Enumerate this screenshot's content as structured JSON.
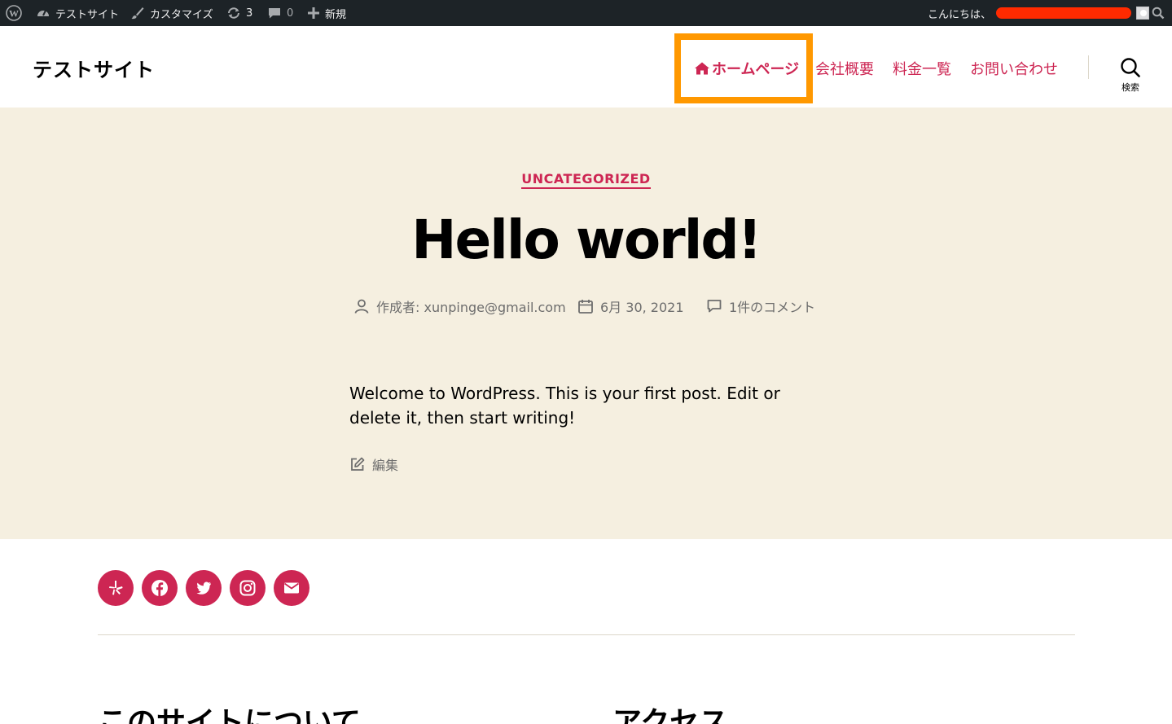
{
  "admin_bar": {
    "site_name": "テストサイト",
    "customize": "カスタマイズ",
    "updates_count": "3",
    "comments_count": "0",
    "new_label": "新規",
    "greeting": "こんにちは、"
  },
  "header": {
    "site_title": "テストサイト",
    "nav": [
      {
        "label": "ホームページ"
      },
      {
        "label": "会社概要"
      },
      {
        "label": "料金一覧"
      },
      {
        "label": "お問い合わせ"
      }
    ],
    "search_label": "検索"
  },
  "post": {
    "category": "UNCATEGORIZED",
    "title": "Hello world!",
    "author": "作成者: xunpinge@gmail.com",
    "date": "6月 30, 2021",
    "comments": "1件のコメント",
    "body": "Welcome to WordPress. This is your first post. Edit or delete it, then start writing!",
    "edit_label": "編集"
  },
  "footer": {
    "widget_titles": [
      "このサイトについて",
      "アクセス"
    ]
  },
  "colors": {
    "accent": "#cd2653",
    "highlight": "#ff9800",
    "admin_bar_bg": "#1d2327",
    "hero_bg": "#f5efe0"
  },
  "icons": {
    "social": [
      "yelp-icon",
      "facebook-icon",
      "twitter-icon",
      "instagram-icon",
      "mail-icon"
    ]
  }
}
